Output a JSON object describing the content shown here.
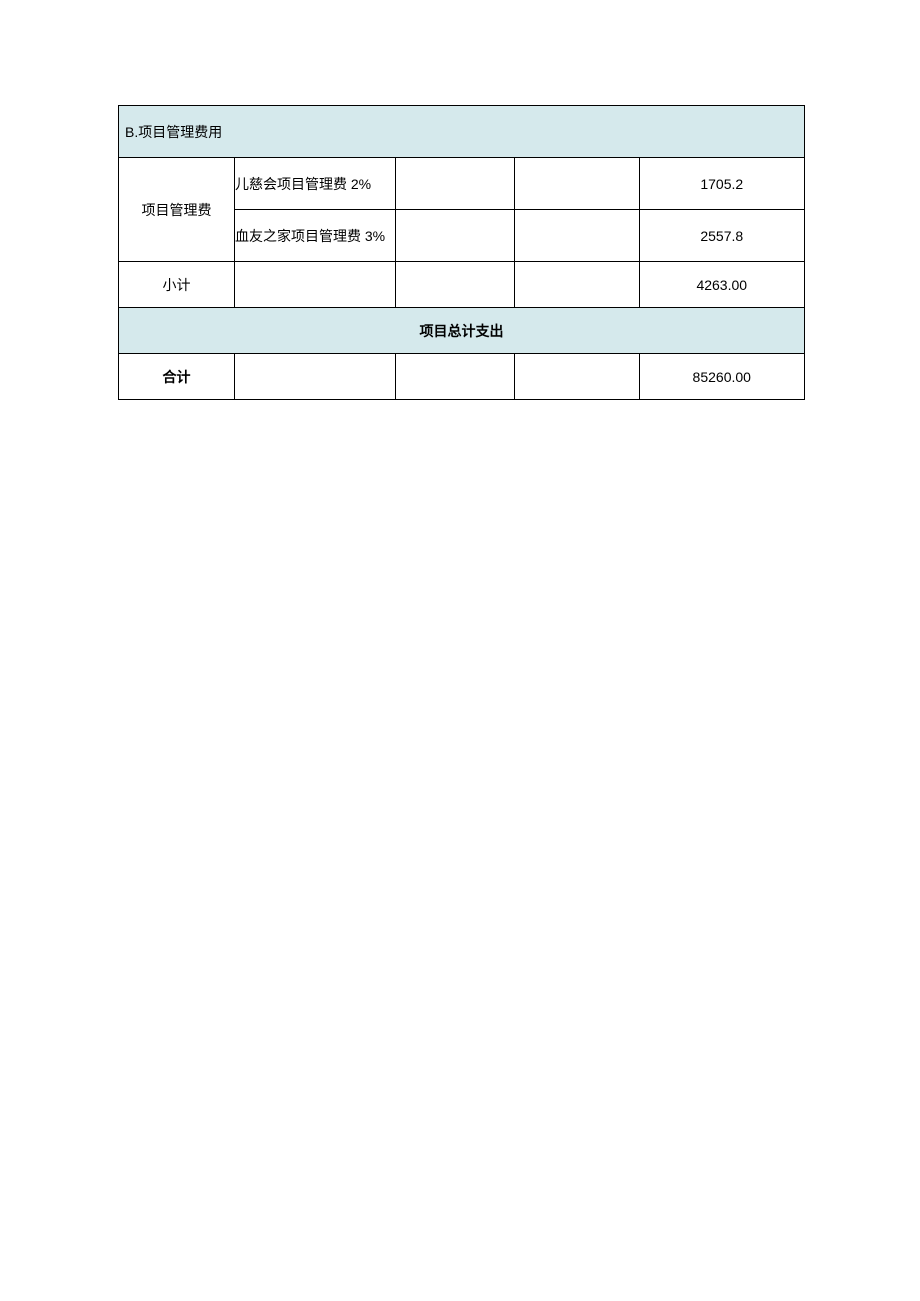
{
  "sectionB": {
    "title": "B.项目管理费用",
    "rows": [
      {
        "label": "项目管理费",
        "items": [
          {
            "desc": "儿慈会项目管理费 2%",
            "amount": "1705.2"
          },
          {
            "desc": "血友之家项目管理费 3%",
            "amount": "2557.8"
          }
        ]
      }
    ],
    "subtotal": {
      "label": "小计",
      "amount": "4263.00"
    }
  },
  "totalSection": {
    "title": "项目总计支出",
    "label": "合计",
    "amount": "85260.00"
  }
}
